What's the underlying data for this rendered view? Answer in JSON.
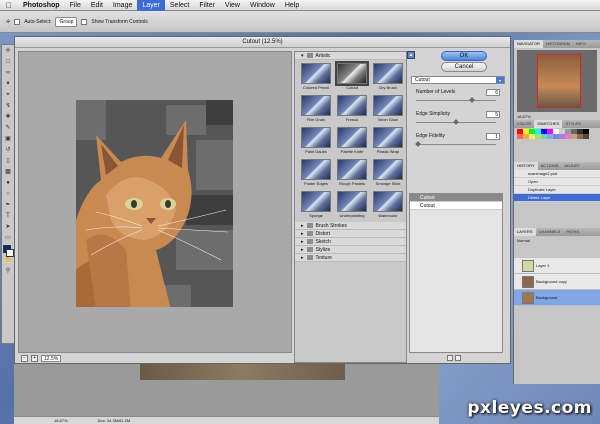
{
  "menubar": {
    "app": "Photoshop",
    "items": [
      "File",
      "Edit",
      "Image",
      "Layer",
      "Select",
      "Filter",
      "View",
      "Window",
      "Help"
    ],
    "active": "Layer"
  },
  "options": {
    "zoom": "16.7%",
    "auto_select": "Auto-Select:",
    "group": "Group",
    "transform": "Show Transform Controls"
  },
  "dialog": {
    "title": "Cutout (12.5%)",
    "zoom": "12.5%",
    "ok": "OK",
    "cancel": "Cancel",
    "filter_select": "Cutout",
    "params": [
      {
        "label": "Number of Levels",
        "value": "6",
        "fraction": 0.71
      },
      {
        "label": "Edge Simplicity",
        "value": "5",
        "fraction": 0.5
      },
      {
        "label": "Edge Fidelity",
        "value": "1",
        "fraction": 0.0
      }
    ],
    "effect_layers": [
      "Cutout",
      "Cutout"
    ]
  },
  "gallery": {
    "open_folder": "Artistic",
    "thumbs": [
      "Colored Pencil",
      "Cutout",
      "Dry Brush",
      "Film Grain",
      "Fresco",
      "Neon Glow",
      "Paint Daubs",
      "Palette Knife",
      "Plastic Wrap",
      "Poster Edges",
      "Rough Pastels",
      "Smudge Stick",
      "Sponge",
      "Underpainting",
      "Watercolor"
    ],
    "selected": "Cutout",
    "folders": [
      "Brush Strokes",
      "Distort",
      "Sketch",
      "Stylize",
      "Texture"
    ]
  },
  "panels": {
    "nav_tabs": [
      "NAVIGATOR",
      "HISTOGRAM",
      "INFO"
    ],
    "nav_zoom": "16.67%",
    "swatch_tabs": [
      "COLOR",
      "SWATCHES",
      "STYLES"
    ],
    "history_tabs": [
      "HISTORY",
      "ACTIONS",
      "ADJUST"
    ],
    "history": [
      "scanimage2.psd",
      "Open",
      "Duplicate Layer",
      "Delete Layer"
    ],
    "layers_tabs": [
      "LAYERS",
      "CHANNELS",
      "PATHS"
    ],
    "blend": "Normal",
    "layers": [
      "Layer 1",
      "Background copy",
      "Background"
    ]
  },
  "status": {
    "zoom": "16.67%",
    "doc": "Doc: 34.3M/81.2M"
  },
  "watermark": "pxleyes.com",
  "colors": {
    "swatches": [
      "#ff0000",
      "#ffff00",
      "#00ff00",
      "#00ffff",
      "#0000ff",
      "#ff00ff",
      "#ffffff",
      "#cccccc",
      "#999999",
      "#666666",
      "#333333",
      "#000000",
      "#f26b6b",
      "#f5a94a",
      "#f7e96b",
      "#a5dd6e",
      "#6ed4a9",
      "#6bb5e8",
      "#7b88e0",
      "#b07be0",
      "#e07bc9",
      "#c8a27a",
      "#8b6a4e",
      "#5a4632"
    ]
  }
}
